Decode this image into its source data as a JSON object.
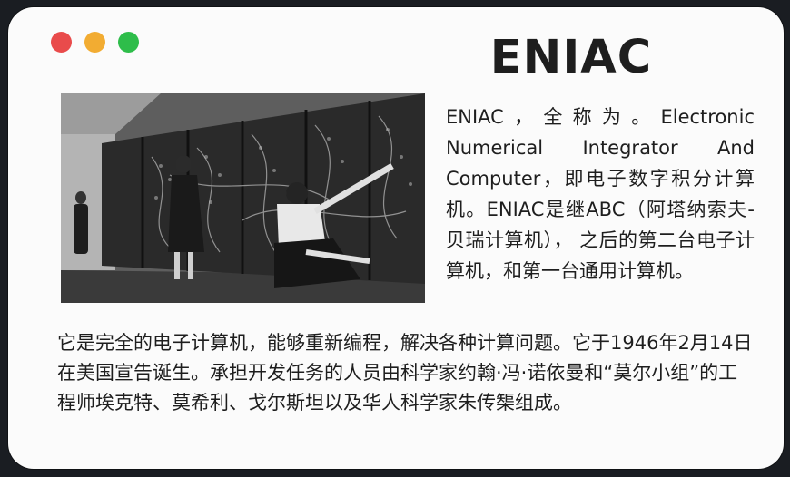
{
  "window": {
    "controls": [
      {
        "name": "close",
        "color": "#e94b4b"
      },
      {
        "name": "minimize",
        "color": "#f2ac32"
      },
      {
        "name": "maximize",
        "color": "#2ebd4a"
      }
    ]
  },
  "card": {
    "title": "ENIAC",
    "intro": "ENIAC，全称为。Electronic Numerical Integrator And Computer，即电子数字积分计算机。ENIAC是继ABC（阿塔纳索夫-贝瑞计算机）， 之后的第二台电子计算机，和第一台通用计算机。",
    "description": "它是完全的电子计算机，能够重新编程，解决各种计算问题。它于1946年2月14日在美国宣告诞生。承担开发任务的人员由科学家约翰·冯·诺依曼和“莫尔小组”的工程师埃克特、莫希利、戈尔斯坦以及华人科学家朱传榘组成。"
  },
  "photo": {
    "subject": "ENIAC computer panels with operators",
    "style": "black-and-white"
  }
}
